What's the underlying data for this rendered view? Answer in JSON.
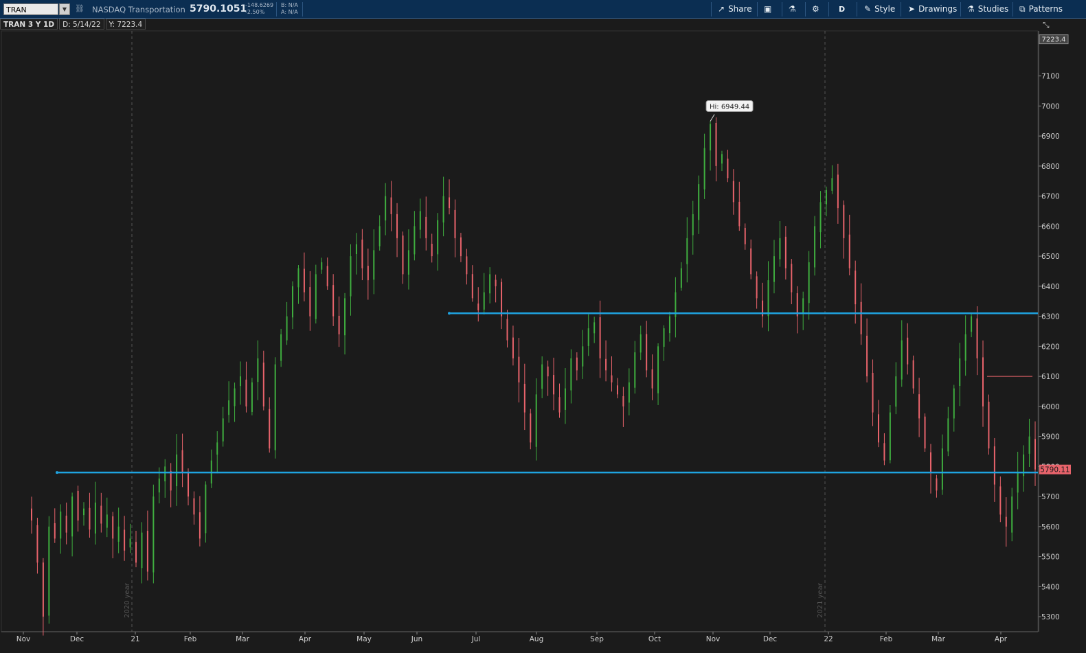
{
  "toolbar": {
    "symbol_value": "TRAN",
    "description": "NASDAQ Transportation",
    "last_price": "5790.1051",
    "net_change": "-148.6269",
    "pct_change": "-2.50%",
    "bid": "B: N/A",
    "ask": "A: N/A",
    "share_label": "Share",
    "aggregation_label": "D",
    "style_label": "Style",
    "drawings_label": "Drawings",
    "studies_label": "Studies",
    "patterns_label": "Patterns"
  },
  "info_bar": {
    "period": "TRAN 3 Y 1D",
    "date": "D: 5/14/22",
    "y_value": "Y: 7223.4"
  },
  "chart_data": {
    "type": "candlestick",
    "symbol": "TRAN",
    "ylim": [
      5250,
      7250
    ],
    "y_ticks": [
      5300,
      5400,
      5500,
      5600,
      5700,
      5800,
      5900,
      6000,
      6100,
      6200,
      6300,
      6400,
      6500,
      6600,
      6700,
      6800,
      6900,
      7000,
      7100
    ],
    "x_ticks": [
      "Nov",
      "Dec",
      "21",
      "Feb",
      "Mar",
      "Apr",
      "May",
      "Jun",
      "Jul",
      "Aug",
      "Sep",
      "Oct",
      "Nov",
      "Dec",
      "22",
      "Feb",
      "Mar",
      "Apr"
    ],
    "year_labels": [
      "2020 year",
      "2021 year"
    ],
    "high_label": "Hi: 6949.44",
    "high_value": 6949.44,
    "crosshair_value_label": "7223.4",
    "crosshair_value": 7223.4,
    "last_price_label": "5790.11",
    "last_price": 5790.11,
    "horizontal_lines": [
      6310,
      5780
    ],
    "up_color": "#3fae3f",
    "down_color": "#e8636b",
    "line_color": "#1fa3e0",
    "path": [
      5620,
      5480,
      5300,
      5600,
      5560,
      5650,
      5580,
      5700,
      5620,
      5660,
      5590,
      5680,
      5610,
      5640,
      5560,
      5600,
      5520,
      5560,
      5480,
      5580,
      5450,
      5700,
      5760,
      5800,
      5720,
      5840,
      5780,
      5700,
      5640,
      5560,
      5740,
      5820,
      5880,
      5960,
      6020,
      6060,
      6100,
      6000,
      6080,
      6160,
      6000,
      5860,
      6140,
      6240,
      6300,
      6400,
      6460,
      6380,
      6300,
      6440,
      6480,
      6400,
      6300,
      6240,
      6360,
      6500,
      6540,
      6460,
      6420,
      6520,
      6600,
      6700,
      6640,
      6560,
      6440,
      6520,
      6600,
      6650,
      6560,
      6500,
      6620,
      6700,
      6660,
      6560,
      6500,
      6440,
      6360,
      6320,
      6380,
      6440,
      6400,
      6300,
      6220,
      6160,
      6080,
      5980,
      5880,
      6040,
      6140,
      6100,
      6040,
      5980,
      6060,
      6160,
      6120,
      6200,
      6260,
      6280,
      6160,
      6120,
      6080,
      6040,
      6000,
      6080,
      6180,
      6240,
      6120,
      6060,
      6200,
      6260,
      6300,
      6380,
      6460,
      6560,
      6640,
      6740,
      6860,
      6940,
      6800,
      6840,
      6760,
      6680,
      6600,
      6540,
      6440,
      6360,
      6300,
      6420,
      6500,
      6560,
      6460,
      6380,
      6300,
      6360,
      6480,
      6600,
      6680,
      6720,
      6760,
      6660,
      6560,
      6460,
      6340,
      6240,
      6100,
      5980,
      5880,
      5820,
      5980,
      6100,
      6220,
      6140,
      6060,
      5960,
      5860,
      5780,
      5720,
      5860,
      5960,
      6060,
      6160,
      6240,
      6300,
      6160,
      6000,
      5860,
      5740,
      5640,
      5600,
      5700,
      5780,
      5840,
      5900,
      5790
    ]
  }
}
